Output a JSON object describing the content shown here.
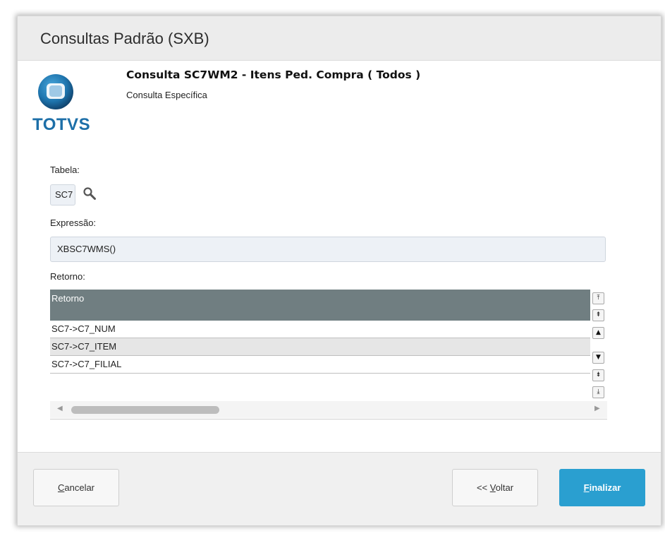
{
  "window": {
    "title": "Consultas Padrão (SXB)"
  },
  "brand": {
    "logo_text": "TOTVS",
    "color": "#1d6fa8"
  },
  "header": {
    "title": "Consulta SC7WM2 - Itens Ped. Compra ( Todos )",
    "subtitle": "Consulta Específica"
  },
  "form": {
    "tabela_label": "Tabela:",
    "tabela_value": "SC7",
    "expressao_label": "Expressão:",
    "expressao_value": "XBSC7WMS()",
    "retorno_label": "Retorno:"
  },
  "grid": {
    "column_header": "Retorno",
    "header_color": "#707e81",
    "rows": [
      "SC7->C7_NUM",
      "SC7->C7_ITEM",
      "SC7->C7_FILIAL"
    ]
  },
  "icons": {
    "search": "search-icon",
    "scroll_top": "scroll-top-icon",
    "page_up": "page-up-icon",
    "scroll_up": "scroll-up-icon",
    "scroll_down": "scroll-down-icon",
    "page_down": "page-down-icon",
    "scroll_bottom": "scroll-bottom-icon"
  },
  "buttons": {
    "cancel": {
      "mnemonic": "C",
      "rest": "ancelar"
    },
    "back": {
      "prefix": "<< ",
      "mnemonic": "V",
      "rest": "oltar"
    },
    "finish": {
      "mnemonic": "F",
      "rest": "inalizar",
      "color": "#2a9fd0"
    }
  }
}
